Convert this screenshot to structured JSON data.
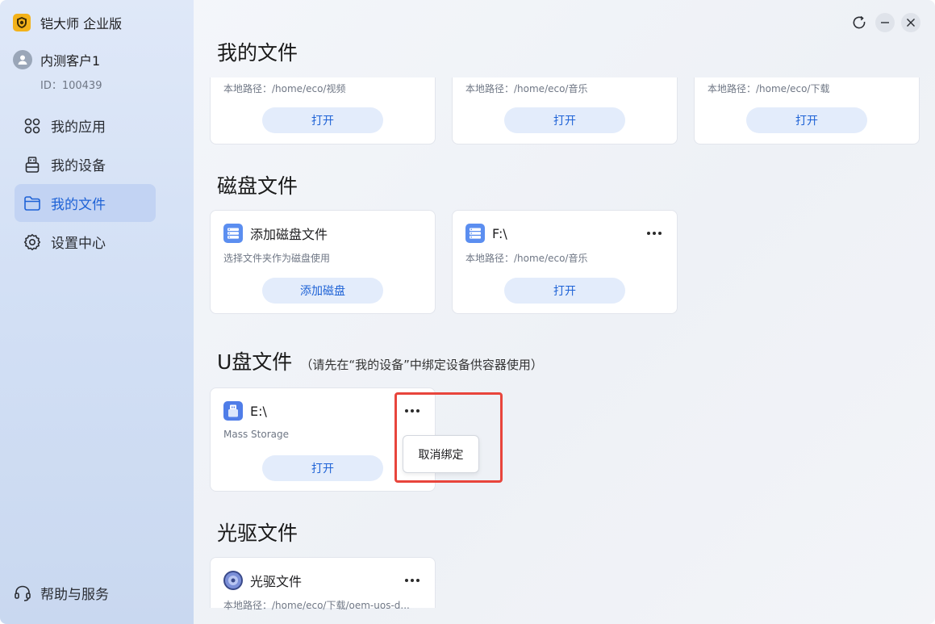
{
  "app": {
    "name": "铠大师 企业版"
  },
  "user": {
    "name": "内测客户1",
    "id_label": "ID：100439"
  },
  "sidebar": {
    "items": [
      {
        "label": "我的应用",
        "icon": "apps-icon",
        "active": false
      },
      {
        "label": "我的设备",
        "icon": "usb-device-icon",
        "active": false
      },
      {
        "label": "我的文件",
        "icon": "folder-icon",
        "active": true
      },
      {
        "label": "设置中心",
        "icon": "gear-icon",
        "active": false
      }
    ],
    "help_label": "帮助与服务"
  },
  "sections": {
    "my_files": {
      "title": "我的文件",
      "cards": [
        {
          "desc": "本地路径：/home/eco/视频",
          "button": "打开"
        },
        {
          "desc": "本地路径：/home/eco/音乐",
          "button": "打开"
        },
        {
          "desc": "本地路径：/home/eco/下载",
          "button": "打开"
        }
      ]
    },
    "disk_files": {
      "title": "磁盘文件",
      "cards": [
        {
          "title": "添加磁盘文件",
          "desc": "选择文件夹作为磁盘使用",
          "button": "添加磁盘"
        },
        {
          "title": "F:\\",
          "desc": "本地路径：/home/eco/音乐",
          "button": "打开"
        }
      ]
    },
    "usb_files": {
      "title": "U盘文件",
      "subtitle": "（请先在“我的设备”中绑定设备供容器使用）",
      "cards": [
        {
          "title": "E:\\",
          "desc": "Mass Storage",
          "button": "打开"
        }
      ],
      "popup_label": "取消绑定"
    },
    "optical_files": {
      "title": "光驱文件",
      "cards": [
        {
          "title": "光驱文件",
          "desc": "本地路径：/home/eco/下载/oem-uos-d..."
        }
      ]
    }
  },
  "colors": {
    "accent": "#1e62d6",
    "button_bg": "#e3ecfb",
    "highlight": "#e8453c",
    "logo": "#f3b21a"
  }
}
